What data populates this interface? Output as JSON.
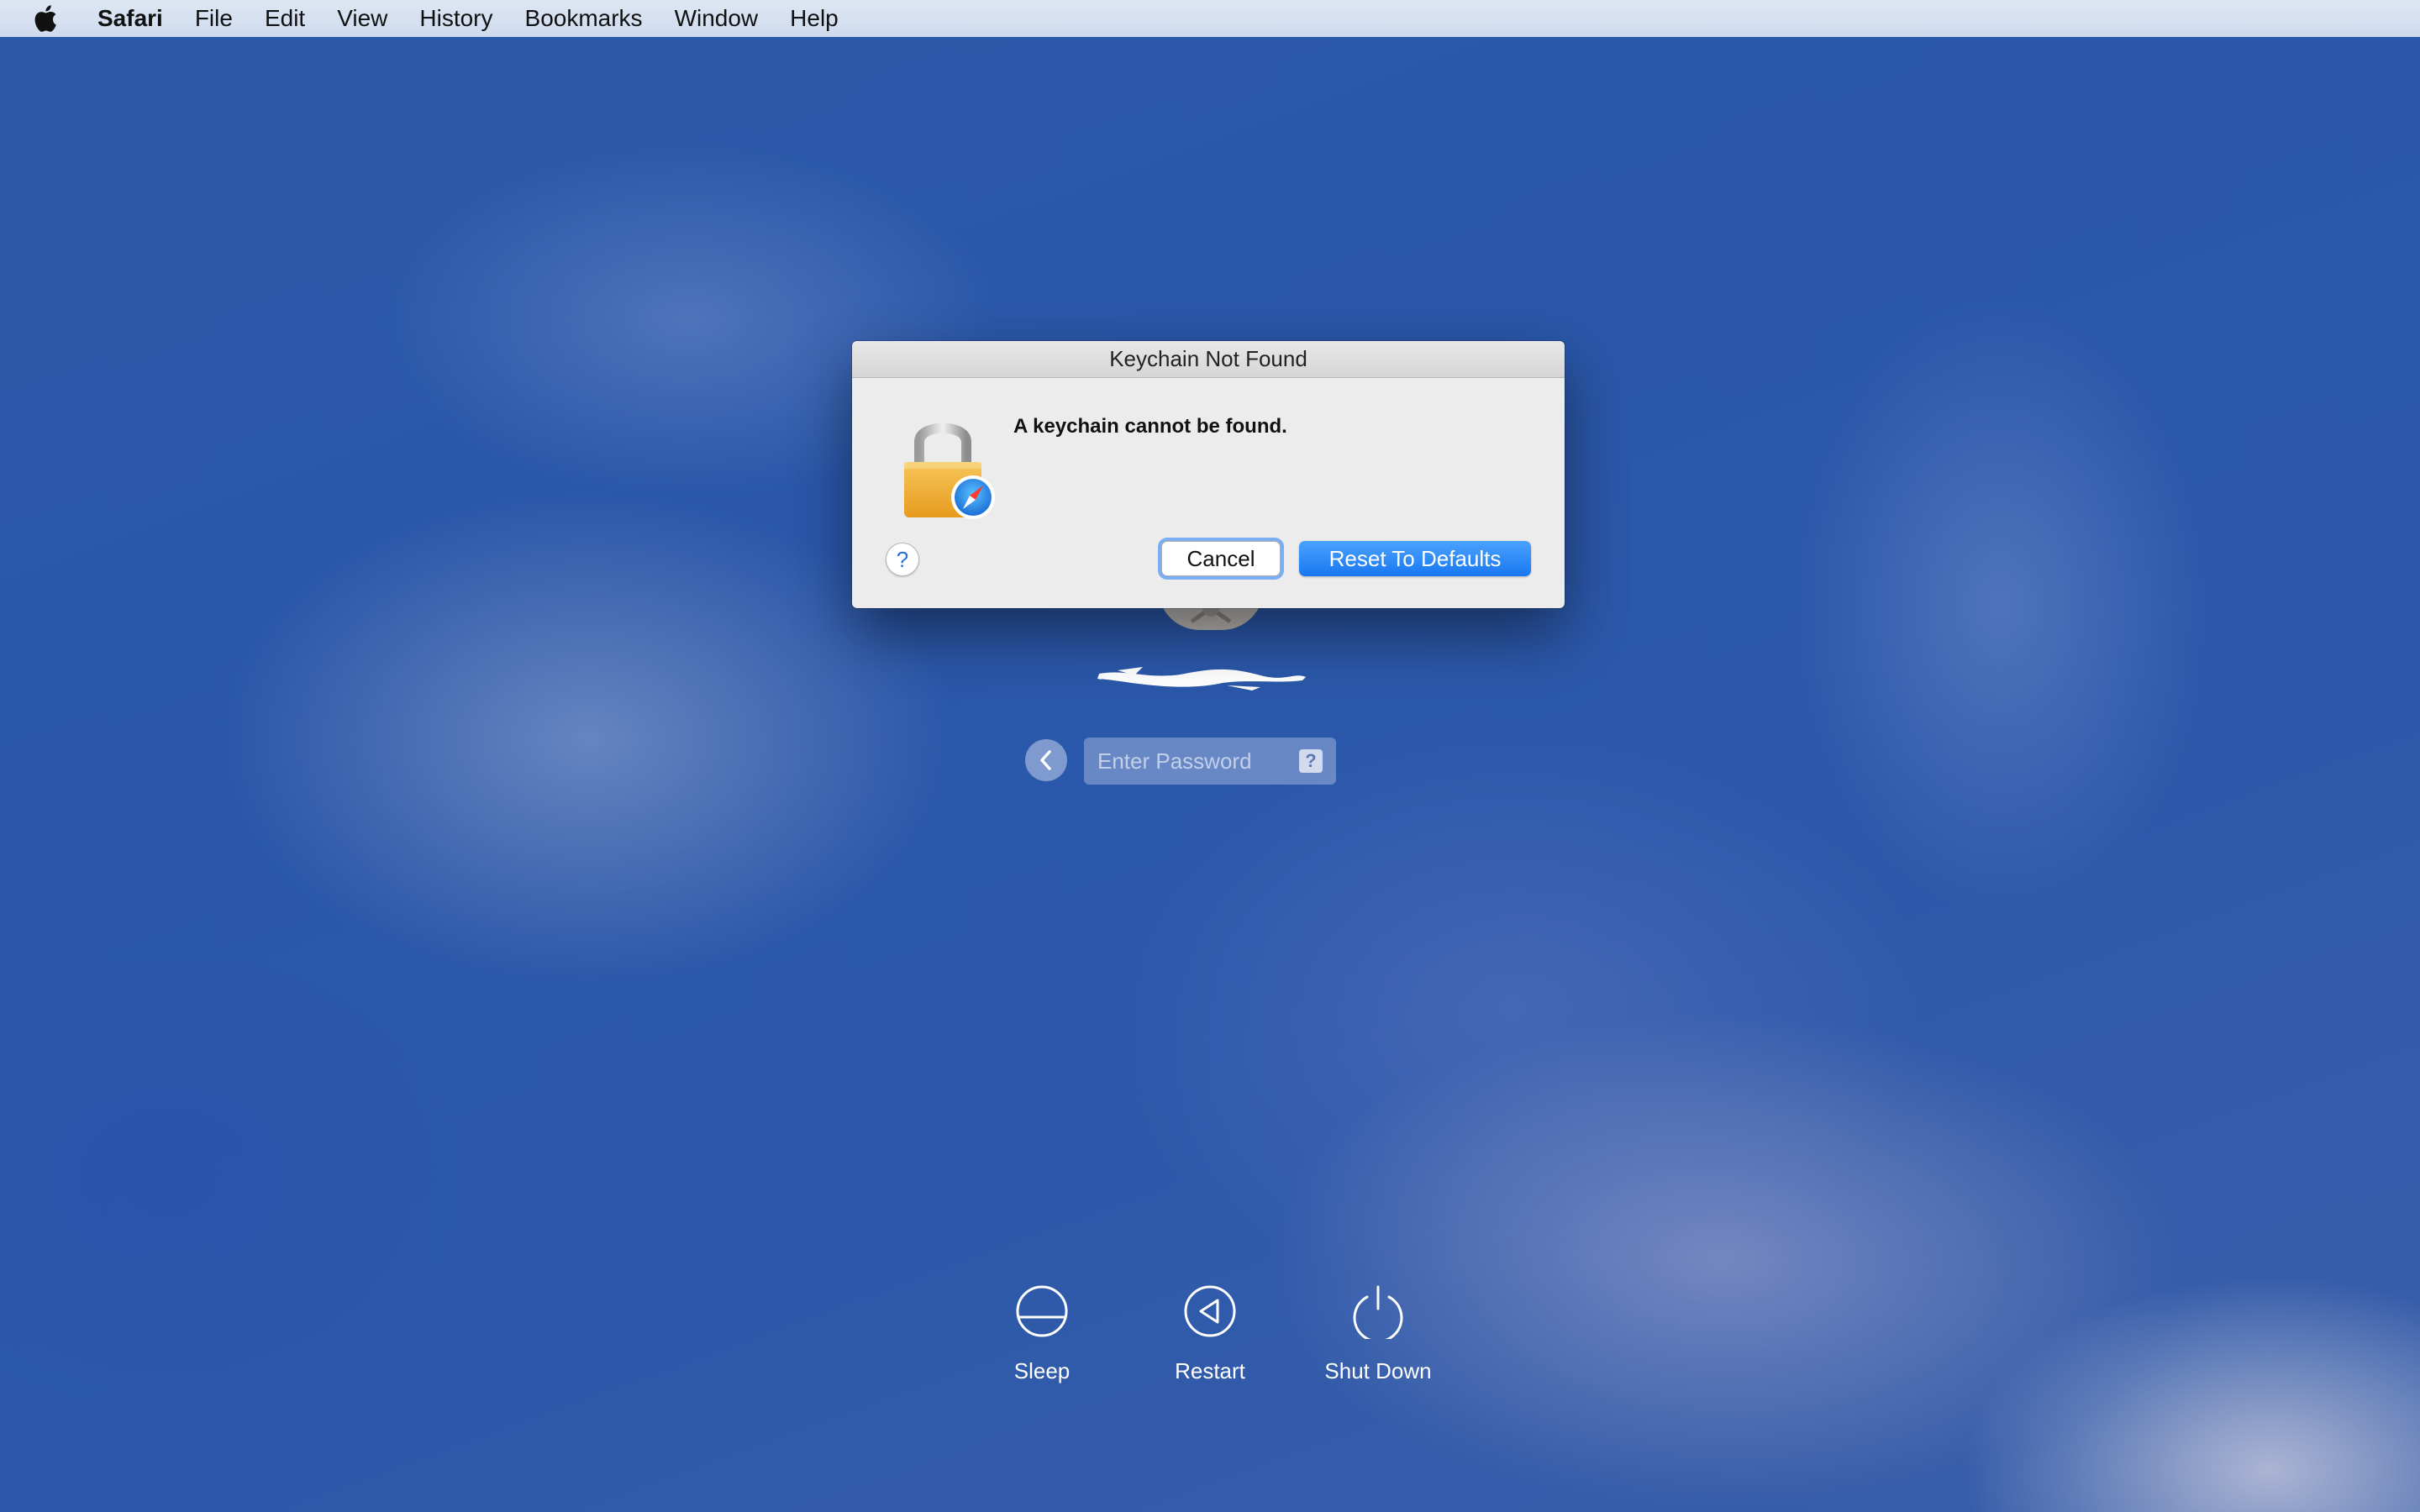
{
  "menubar": {
    "apple_icon": "apple-logo",
    "items": [
      "Safari",
      "File",
      "Edit",
      "View",
      "History",
      "Bookmarks",
      "Window",
      "Help"
    ]
  },
  "dialog": {
    "title": "Keychain Not Found",
    "message": "A keychain cannot be found.",
    "icon": "keychain-lock-safari-icon",
    "help_label": "?",
    "cancel_label": "Cancel",
    "reset_label": "Reset To Defaults",
    "accent_color": "#1878f2"
  },
  "login": {
    "password_placeholder": "Enter Password",
    "hint_label": "?",
    "back_icon": "chevron-left-icon"
  },
  "power": {
    "sleep_label": "Sleep",
    "restart_label": "Restart",
    "shutdown_label": "Shut Down"
  }
}
